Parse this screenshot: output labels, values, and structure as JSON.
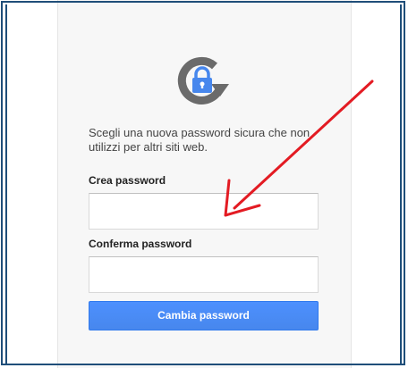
{
  "form": {
    "prompt": "Scegli una nuova password sicura che non utilizzi per altri siti web.",
    "create_label": "Crea password",
    "create_value": "",
    "confirm_label": "Conferma password",
    "confirm_value": "",
    "submit_label": "Cambia password"
  },
  "icons": {
    "header": "lock-refresh-icon",
    "annotation": "red-arrow-annotation"
  },
  "colors": {
    "frame_border": "#1f4e79",
    "button": "#4787ed",
    "icon_gray": "#6b6b6b",
    "lock_blue": "#4787ed",
    "annotation": "#e31b23"
  }
}
